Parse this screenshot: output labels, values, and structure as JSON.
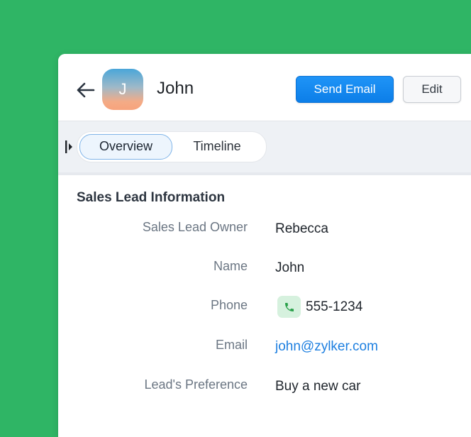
{
  "header": {
    "avatar_initial": "J",
    "lead_name": "John",
    "send_email_label": "Send Email",
    "edit_label": "Edit"
  },
  "tabs": [
    {
      "label": "Overview",
      "active": true
    },
    {
      "label": "Timeline",
      "active": false
    }
  ],
  "section": {
    "title": "Sales Lead Information",
    "fields": [
      {
        "label": "Sales Lead Owner",
        "value": "Rebecca"
      },
      {
        "label": "Name",
        "value": "John"
      },
      {
        "label": "Phone",
        "value": "555-1234"
      },
      {
        "label": "Email",
        "value": "john@zylker.com"
      },
      {
        "label": "Lead's Preference",
        "value": "Buy a new car"
      }
    ]
  },
  "colors": {
    "background": "#2fb565",
    "primary": "#0c7ee8",
    "link": "#1d7fe0",
    "phone_chip": "#d6f1de",
    "phone_icon": "#2aa04a"
  },
  "icons": {
    "back": "arrow-left-icon",
    "phone": "phone-icon",
    "collapse": "sidebar-toggle-icon"
  }
}
